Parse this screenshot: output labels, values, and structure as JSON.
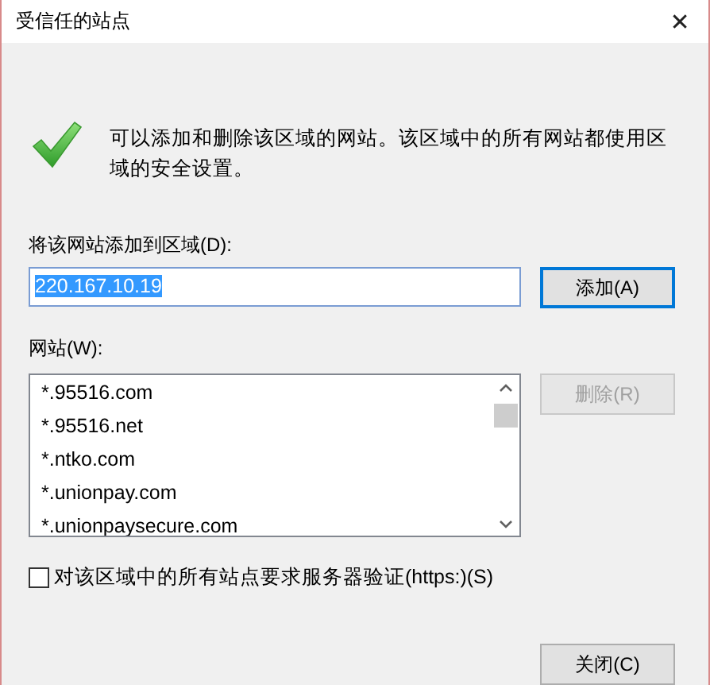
{
  "window": {
    "title": "受信任的站点",
    "close": "✕"
  },
  "description": "可以添加和删除该区域的网站。该区域中的所有网站都使用区域的安全设置。",
  "add_field": {
    "label": "将该网站添加到区域(D):",
    "value": "220.167.10.19",
    "value_selected": true
  },
  "add_button": {
    "label": "添加(A)",
    "default": true,
    "disabled": false
  },
  "sites": {
    "label": "网站(W):",
    "items": [
      "*.95516.com",
      "*.95516.net",
      "*.ntko.com",
      "*.unionpay.com",
      "*.unionpaysecure.com"
    ]
  },
  "remove_button": {
    "label": "删除(R)",
    "disabled": true
  },
  "require_https": {
    "label": "对该区域中的所有站点要求服务器验证(https:)(S)",
    "checked": false
  },
  "close_button": {
    "label": "关闭(C)",
    "disabled": false
  }
}
